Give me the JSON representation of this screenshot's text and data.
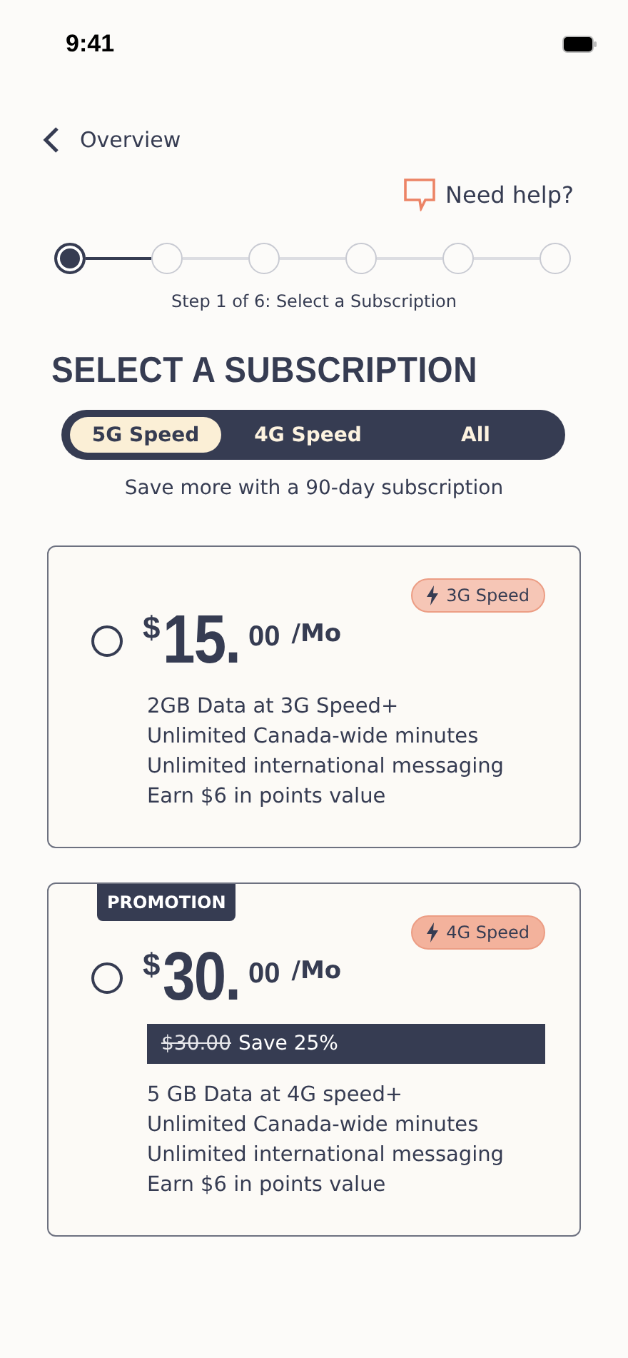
{
  "status_bar": {
    "time": "9:41"
  },
  "nav": {
    "back_label": "Overview",
    "help_label": "Need help?"
  },
  "stepper": {
    "steps": [
      {
        "selected": true
      },
      {
        "selected": false
      },
      {
        "selected": false
      },
      {
        "selected": false
      },
      {
        "selected": false
      },
      {
        "selected": false
      }
    ],
    "caption": "Step 1 of 6: Select a Subscription"
  },
  "title": "SELECT A SUBSCRIPTION",
  "tabs": [
    {
      "label": "5G Speed",
      "selected": true
    },
    {
      "label": "4G Speed",
      "selected": false
    },
    {
      "label": "All",
      "selected": false
    }
  ],
  "subtitle": "Save more with a 90-day subscription",
  "plans": [
    {
      "selected": false,
      "speed_badge": "3G Speed",
      "color": "#f6c6b6",
      "currency": "$",
      "amount": "15.",
      "cents": "00",
      "period": "/Mo",
      "features": [
        "2GB Data at 3G Speed+",
        "Unlimited Canada-wide minutes",
        "Unlimited international messaging",
        "Earn $6 in points value"
      ]
    },
    {
      "selected": false,
      "promotion": "PROMOTION",
      "speed_badge": "4G Speed",
      "color": "#f3b29c",
      "currency": "$",
      "amount": "30.",
      "cents": "00",
      "period": "/Mo",
      "old_price": "$30.00",
      "savings": "Save 25%",
      "features": [
        "5 GB Data at 4G speed+",
        "Unlimited Canada-wide minutes",
        "Unlimited international messaging",
        "Earn $6 in points value"
      ]
    }
  ]
}
